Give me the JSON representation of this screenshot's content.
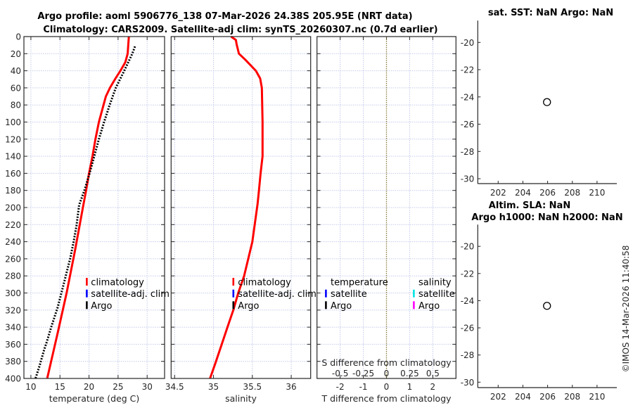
{
  "figure": {
    "title_line1": "Argo profile: aoml 5906776_138 07-Mar-2026 24.38S 205.95E (NRT data)",
    "title_line2": "Climatology: CARS2009. Satellite-adj clim: synTS_20260307.nc (0.7d earlier)",
    "credit": "©IMOS 14-Mar-2026 11:40:58"
  },
  "colors": {
    "climatology": "#ff0000",
    "satellite_adj_clim": "#0000ff",
    "argo": "#000000",
    "t_satellite": "#0000ff",
    "t_argo": "#000000",
    "s_satellite": "#00e5e5",
    "s_argo": "#ff00ff",
    "zero_line": "#8a7a3a",
    "grid": "#c4cbea"
  },
  "chart_data": [
    {
      "id": "temperature",
      "type": "line",
      "title": "",
      "xlabel": "temperature (deg C)",
      "ylabel": "",
      "xlim": [
        8.8,
        33
      ],
      "ylim": [
        400,
        0
      ],
      "xticks": [
        "10",
        "15",
        "20",
        "25",
        "30"
      ],
      "yticks": [
        "0",
        "20",
        "40",
        "60",
        "80",
        "100",
        "120",
        "140",
        "160",
        "180",
        "200",
        "220",
        "240",
        "260",
        "280",
        "300",
        "320",
        "340",
        "360",
        "380",
        "400"
      ],
      "grid": true,
      "legend": {
        "placement": "lower-right",
        "entries": [
          {
            "label": "climatology",
            "color": "#ff0000"
          },
          {
            "label": "satellite-adj. clim",
            "color": "#0000ff"
          },
          {
            "label": "Argo",
            "color": "#000000"
          }
        ]
      },
      "series": [
        {
          "name": "climatology",
          "style": "solid",
          "color": "#ff0000",
          "depth": [
            0,
            20,
            30,
            40,
            49,
            60,
            70,
            80,
            100,
            120,
            140,
            160,
            180,
            198,
            250,
            300,
            350,
            400
          ],
          "values": [
            26.85,
            26.65,
            26.25,
            25.4,
            24.55,
            23.6,
            22.9,
            22.5,
            21.7,
            21.1,
            20.6,
            20.0,
            19.5,
            19.0,
            17.6,
            16.15,
            14.5,
            12.8
          ]
        },
        {
          "name": "Argo",
          "style": "dotted",
          "color": "#000000",
          "depth": [
            11.5,
            20,
            40,
            60,
            80,
            100,
            120,
            140,
            160,
            180,
            197,
            221,
            240,
            260,
            280,
            300,
            317,
            340,
            358,
            366,
            385,
            400
          ],
          "values": [
            27.9,
            27.45,
            26.05,
            24.6,
            23.55,
            22.6,
            21.7,
            20.9,
            20.1,
            19.2,
            18.3,
            17.85,
            17.35,
            16.75,
            16.0,
            15.25,
            14.6,
            13.5,
            12.7,
            12.3,
            11.5,
            10.8
          ]
        }
      ]
    },
    {
      "id": "salinity",
      "type": "line",
      "title": "",
      "xlabel": "salinity",
      "ylabel": "",
      "xlim": [
        34.455,
        36.25
      ],
      "ylim": [
        400,
        0
      ],
      "xticks": [
        "34.5",
        "35",
        "35.5",
        "36"
      ],
      "grid": true,
      "legend": {
        "placement": "lower-right",
        "entries": [
          {
            "label": "climatology",
            "color": "#ff0000"
          },
          {
            "label": "satellite-adj. clim",
            "color": "#0000ff"
          },
          {
            "label": "Argo",
            "color": "#000000"
          }
        ]
      },
      "series": [
        {
          "name": "climatology",
          "style": "solid",
          "color": "#ff0000",
          "depth": [
            0,
            4,
            9,
            20,
            27,
            40,
            49,
            60,
            100,
            140,
            160,
            180,
            196,
            240,
            280,
            300,
            319,
            340,
            360,
            382,
            400
          ],
          "values": [
            35.227,
            35.288,
            35.297,
            35.327,
            35.409,
            35.545,
            35.6,
            35.622,
            35.631,
            35.631,
            35.606,
            35.585,
            35.567,
            35.5,
            35.394,
            35.318,
            35.258,
            35.18,
            35.106,
            35.025,
            34.955
          ]
        }
      ]
    },
    {
      "id": "difference",
      "type": "line",
      "title": "",
      "xlabel": "T difference from climatology",
      "secondary_xlabel": "S difference from climatology",
      "ylabel": "",
      "xlim": [
        -3,
        3
      ],
      "ylim": [
        400,
        0
      ],
      "xticks": [
        "-2",
        "-1",
        "0",
        "1",
        "2"
      ],
      "secondary_xticks": [
        "-0.5",
        "-0.25",
        "0",
        "0.25",
        "0.5"
      ],
      "secondary_xlim": [
        -0.75,
        0.75
      ],
      "grid": true,
      "zero_line": true,
      "legend": {
        "placement": "lower",
        "groups": [
          {
            "heading": "temperature",
            "entries": [
              {
                "label": "satellite",
                "color": "#0000ff"
              },
              {
                "label": "Argo",
                "color": "#000000"
              }
            ]
          },
          {
            "heading": "salinity",
            "entries": [
              {
                "label": "satellite",
                "color": "#00e5e5"
              },
              {
                "label": "Argo",
                "color": "#ff00ff"
              }
            ]
          }
        ]
      },
      "series": []
    },
    {
      "id": "sst-map",
      "type": "scatter",
      "title": [
        "sat. SST: NaN Argo: NaN"
      ],
      "xlabel": "",
      "ylabel": "",
      "xlim": [
        200.35,
        211.6
      ],
      "ylim": [
        -30.36,
        -18.4
      ],
      "xticks": [
        "202",
        "204",
        "206",
        "208",
        "210"
      ],
      "yticks": [
        "-20",
        "-22",
        "-24",
        "-26",
        "-28",
        "-30"
      ],
      "grid": false,
      "points": [
        {
          "x": 205.95,
          "y": -24.38,
          "marker": "open-circle"
        }
      ]
    },
    {
      "id": "sla-map",
      "type": "scatter",
      "title": [
        "Altim. SLA: NaN",
        "Argo h1000: NaN h2000: NaN"
      ],
      "xlabel": "",
      "ylabel": "",
      "xlim": [
        200.35,
        211.6
      ],
      "ylim": [
        -30.4,
        -18.4
      ],
      "xticks": [
        "202",
        "204",
        "206",
        "208",
        "210"
      ],
      "yticks": [
        "-20",
        "-22",
        "-24",
        "-26",
        "-28",
        "-30"
      ],
      "grid": false,
      "points": [
        {
          "x": 205.95,
          "y": -24.38,
          "marker": "open-circle"
        }
      ]
    }
  ]
}
